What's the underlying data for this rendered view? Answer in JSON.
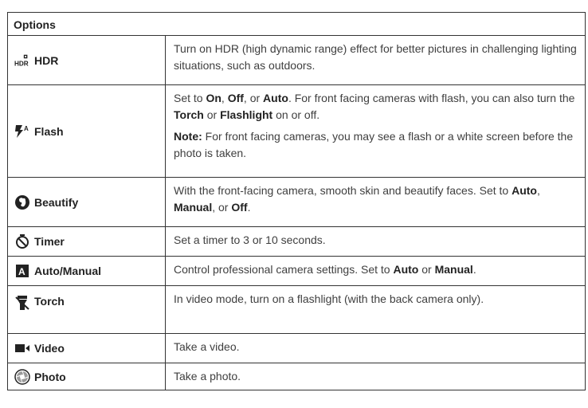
{
  "header": {
    "title": "Options"
  },
  "rows": [
    {
      "icon": "hdr-icon",
      "label": "HDR",
      "desc": [
        [
          {
            "t": "Turn on HDR (high dynamic range) effect for better pictures in challenging lighting situations, such as outdoors."
          }
        ]
      ]
    },
    {
      "icon": "flash-auto-icon",
      "label": "Flash",
      "desc": [
        [
          {
            "t": "Set to "
          },
          {
            "t": "On",
            "b": true
          },
          {
            "t": ", "
          },
          {
            "t": "Off",
            "b": true
          },
          {
            "t": ", or "
          },
          {
            "t": "Auto",
            "b": true
          },
          {
            "t": ". For front facing cameras with flash, you can also turn the "
          },
          {
            "t": "Torch",
            "b": true
          },
          {
            "t": " or "
          },
          {
            "t": "Flashlight",
            "b": true
          },
          {
            "t": " on or off."
          }
        ],
        [
          {
            "t": "Note:",
            "b": true
          },
          {
            "t": " For front facing cameras, you may see a flash or a white screen before the photo is taken."
          }
        ]
      ]
    },
    {
      "icon": "beautify-face-icon",
      "label": "Beautify",
      "desc": [
        [
          {
            "t": "With the front-facing camera, smooth skin and beautify faces. Set to "
          },
          {
            "t": "Auto",
            "b": true
          },
          {
            "t": ", "
          },
          {
            "t": "Manual",
            "b": true
          },
          {
            "t": ", or "
          },
          {
            "t": "Off",
            "b": true
          },
          {
            "t": "."
          }
        ]
      ]
    },
    {
      "icon": "timer-icon",
      "label": "Timer",
      "desc": [
        [
          {
            "t": "Set a timer to 3 or 10 seconds."
          }
        ]
      ]
    },
    {
      "icon": "auto-mode-icon",
      "label": "Auto/Manual",
      "desc": [
        [
          {
            "t": "Control professional camera settings. Set to "
          },
          {
            "t": "Auto",
            "b": true
          },
          {
            "t": " or "
          },
          {
            "t": "Manual",
            "b": true
          },
          {
            "t": "."
          }
        ]
      ]
    },
    {
      "icon": "torch-icon",
      "label": "Torch",
      "desc": [
        [
          {
            "t": "In video mode, turn on a flashlight (with the back camera only)."
          }
        ]
      ]
    },
    {
      "icon": "video-camera-icon",
      "label": "Video",
      "desc": [
        [
          {
            "t": "Take a video."
          }
        ]
      ]
    },
    {
      "icon": "shutter-icon",
      "label": "Photo",
      "desc": [
        [
          {
            "t": "Take a photo."
          }
        ]
      ]
    }
  ]
}
